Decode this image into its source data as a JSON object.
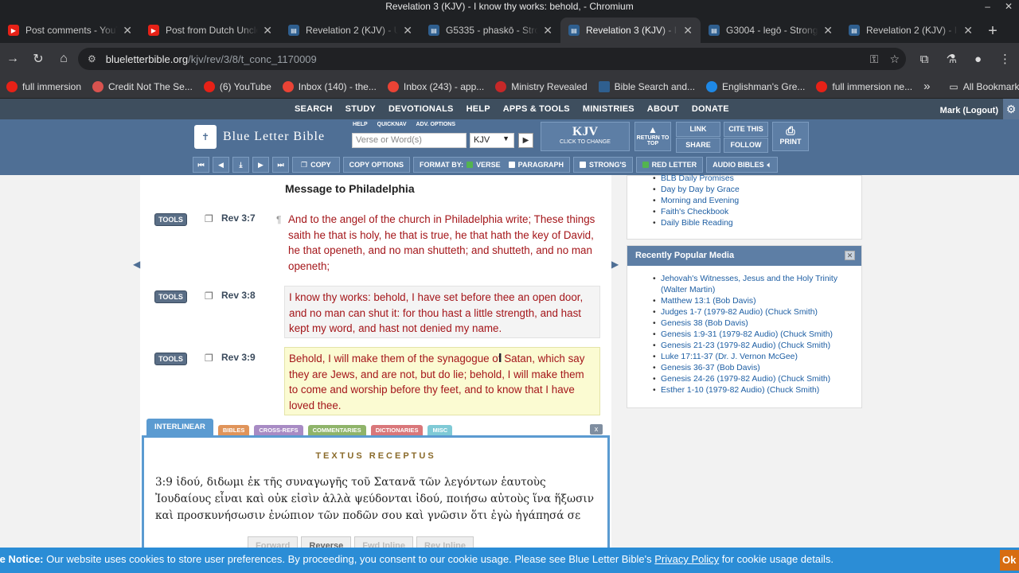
{
  "window": {
    "title": "Revelation 3 (KJV) - I know thy works: behold, - Chromium"
  },
  "tabs": [
    {
      "label": "Post comments - YouT",
      "icon": "youtube-icon"
    },
    {
      "label": "Post from Dutch Uncle",
      "icon": "youtube-icon"
    },
    {
      "label": "Revelation 2 (KJV) - U",
      "icon": "blb-icon"
    },
    {
      "label": "G5335 - phaskō - Stron",
      "icon": "blb-icon"
    },
    {
      "label": "Revelation 3 (KJV) - I k",
      "icon": "blb-icon",
      "active": true
    },
    {
      "label": "G3004 - legō - Strong's",
      "icon": "blb-icon"
    },
    {
      "label": "Revelation 2 (KJV) - I k",
      "icon": "blb-icon"
    }
  ],
  "address": {
    "host": "blueletterbible.org",
    "path": "/kjv/rev/3/8/t_conc_1170009"
  },
  "bookmarks": [
    {
      "label": "full immersion",
      "color": "#e62117"
    },
    {
      "label": "Credit Not The Se...",
      "color": "#d9534f"
    },
    {
      "label": "(6) YouTube",
      "color": "#e62117"
    },
    {
      "label": "Inbox (140) - the...",
      "color": "#ea4335"
    },
    {
      "label": "Inbox (243) - app...",
      "color": "#ea4335"
    },
    {
      "label": "Ministry Revealed",
      "color": "#c62828"
    },
    {
      "label": "Bible Search and...",
      "color": "#2f5f8f"
    },
    {
      "label": "Englishman's Gre...",
      "color": "#1e88e5"
    },
    {
      "label": "full immersion ne...",
      "color": "#e62117"
    }
  ],
  "bookmarks_more": "»",
  "bookmarks_all": "All Bookmarks",
  "site_menu": [
    "SEARCH",
    "STUDY",
    "DEVOTIONALS",
    "HELP",
    "APPS & TOOLS",
    "MINISTRIES",
    "ABOUT",
    "DONATE"
  ],
  "user": "Mark (Logout)",
  "header": {
    "logo_text": "Blue Letter Bible",
    "small_links": [
      "HELP",
      "QUICKNAV",
      "ADV. OPTIONS"
    ],
    "search_placeholder": "Verse or Word(s)",
    "version_value": "KJV",
    "kjv_big": "KJV",
    "kjv_small": "CLICK TO CHANGE",
    "return_top": "RETURN TO TOP",
    "link": "LINK",
    "cite": "CITE THIS",
    "share": "SHARE",
    "follow": "FOLLOW",
    "print": "PRINT"
  },
  "controls": {
    "copy": "COPY",
    "copy_options": "COPY OPTIONS",
    "format_by": "FORMAT BY:",
    "verse": "VERSE",
    "paragraph": "PARAGRAPH",
    "strongs": "STRONG'S",
    "red_letter": "RED LETTER",
    "audio": "AUDIO BIBLES"
  },
  "section_heading": "Message to Philadelphia",
  "verses": [
    {
      "tools": "TOOLS",
      "ref": "Rev 3:7",
      "text": "And to the angel of the church in Philadelphia write; These things saith he that is holy, he that is true, he that hath the key of David, he that openeth, and no man shutteth; and shutteth, and no man openeth;"
    },
    {
      "tools": "TOOLS",
      "ref": "Rev 3:8",
      "text": "I know thy works: behold, I have set before thee an open door, and no man can shut it: for thou hast a little strength, and hast kept my word, and hast not denied my name."
    },
    {
      "tools": "TOOLS",
      "ref": "Rev 3:9",
      "text": "Behold, I will make them of the synagogue of Satan, which say they are Jews, and are not, but do lie; behold, I will make them to come and worship before thy feet, and to know that I have loved thee."
    }
  ],
  "resource_tabs": [
    {
      "label": "INTERLINEAR",
      "color": "#5b9bd1"
    },
    {
      "label": "BIBLES",
      "color": "#e0945a"
    },
    {
      "label": "CROSS-REFS",
      "color": "#a88bc4"
    },
    {
      "label": "COMMENTARIES",
      "color": "#8fb46a"
    },
    {
      "label": "DICTIONARIES",
      "color": "#d9777a"
    },
    {
      "label": "MISC",
      "color": "#7fcad6"
    }
  ],
  "interlinear": {
    "title": "TEXTUS RECEPTUS",
    "text": "3:9  ἰδού, διδωμι ἐκ τῆς συναγωγῆς τοῦ Σατανᾶ τῶν λεγόντων ἑαυτοὺς Ἰουδαίους εἶναι καὶ οὐκ εἰσὶν ἀλλὰ ψεύδονται ἰδού, ποιήσω αὐτοὺς ἵνα ἥξωσιν καὶ προσκυνήσωσιν ἐνώπιον τῶν ποδῶν σου καὶ γνῶσιν ὅτι ἐγὼ ἠγάπησά σε",
    "buttons": [
      "Forward",
      "Reverse",
      "Fwd Inline",
      "Rev Inline"
    ]
  },
  "devotionals": [
    "BLB Daily Promises",
    "Day by Day by Grace",
    "Morning and Evening",
    "Faith's Checkbook",
    "Daily Bible Reading"
  ],
  "popular_media": {
    "title": "Recently Popular Media",
    "items": [
      "Jehovah's Witnesses, Jesus and the Holy Trinity (Walter Martin)",
      "Matthew 13:1 (Bob Davis)",
      "Judges 1-7 (1979-82 Audio) (Chuck Smith)",
      "Genesis 38 (Bob Davis)",
      "Genesis 1:9-31 (1979-82 Audio) (Chuck Smith)",
      "Genesis 21-23 (1979-82 Audio) (Chuck Smith)",
      "Luke 17:11-37 (Dr. J. Vernon McGee)",
      "Genesis 36-37 (Bob Davis)",
      "Genesis 24-26 (1979-82 Audio) (Chuck Smith)",
      "Esther 1-10 (1979-82 Audio) (Chuck Smith)"
    ]
  },
  "cookie": {
    "label": "ie Notice:",
    "text": " Our website uses cookies to store user preferences. By proceeding, you consent to our cookie usage. Please see Blue Letter Bible's ",
    "link": "Privacy Policy",
    "tail": " for cookie usage details.",
    "ok": "Ok"
  },
  "close_x": "x"
}
